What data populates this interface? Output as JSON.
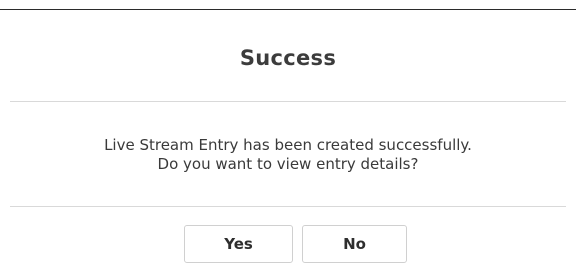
{
  "dialog": {
    "title": "Success",
    "message_line1": "Live Stream Entry has been created successfully.",
    "message_line2": "Do you want to view entry details?",
    "yes_label": "Yes",
    "no_label": "No"
  }
}
